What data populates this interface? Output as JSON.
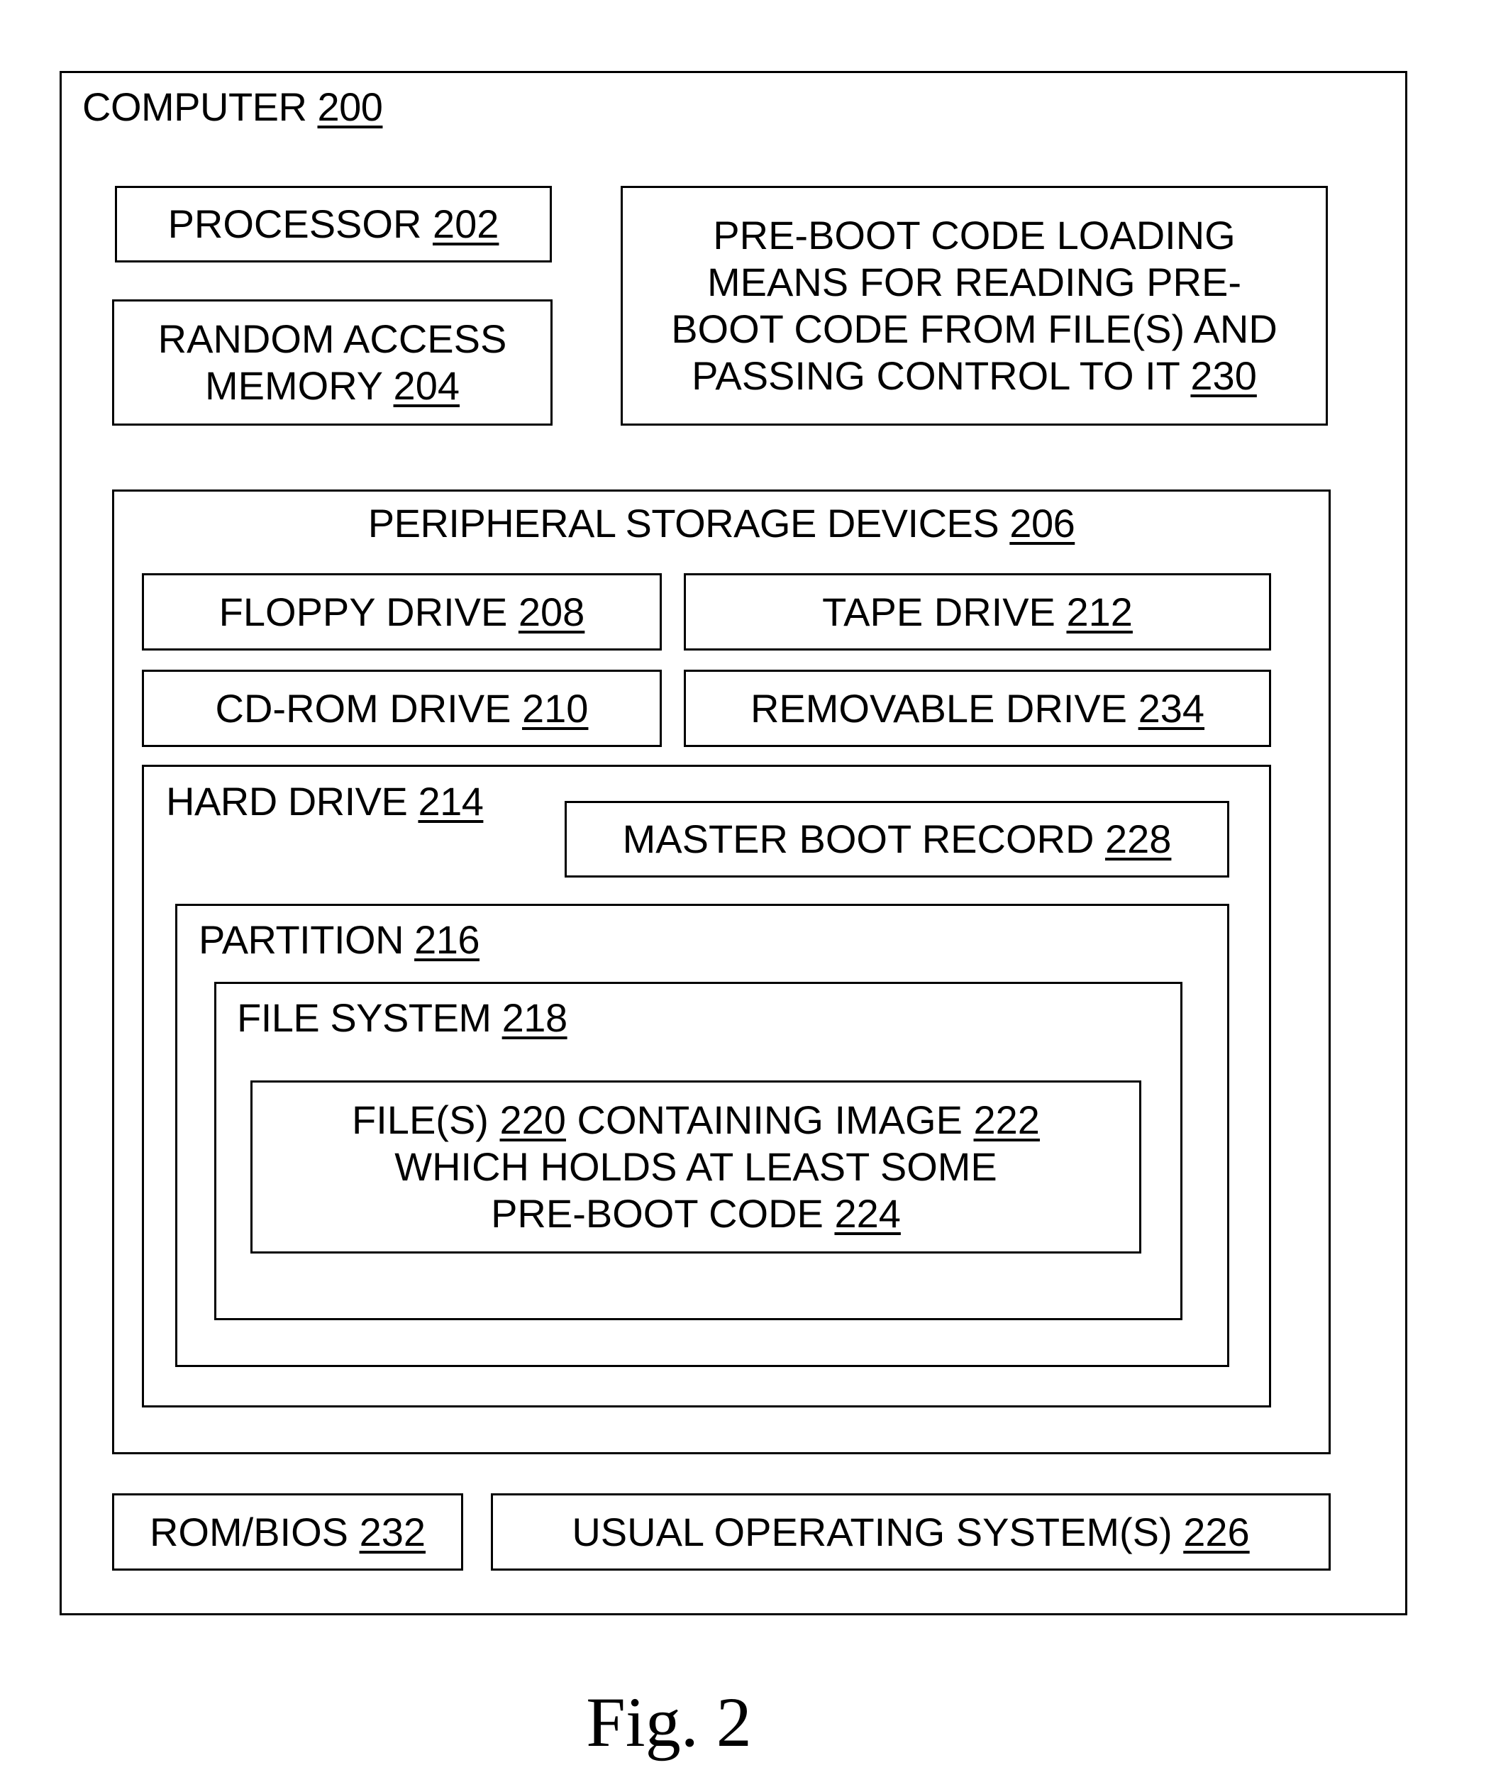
{
  "figure": {
    "caption": "Fig. 2",
    "computer": {
      "label": "COMPUTER",
      "ref": "200"
    },
    "processor": {
      "label": "PROCESSOR",
      "ref": "202"
    },
    "ram": {
      "line1": "RANDOM ACCESS",
      "line2": "MEMORY",
      "ref": "204"
    },
    "preboot_loader": {
      "line1": "PRE-BOOT CODE LOADING",
      "line2": "MEANS FOR READING PRE-",
      "line3": "BOOT CODE FROM FILE(S) AND",
      "line4": "PASSING CONTROL TO IT",
      "ref": "230"
    },
    "peripheral": {
      "label": "PERIPHERAL STORAGE DEVICES",
      "ref": "206"
    },
    "floppy": {
      "label": "FLOPPY DRIVE",
      "ref": "208"
    },
    "tape": {
      "label": "TAPE DRIVE",
      "ref": "212"
    },
    "cdrom": {
      "label": "CD-ROM DRIVE",
      "ref": "210"
    },
    "removable": {
      "label": "REMOVABLE DRIVE",
      "ref": "234"
    },
    "hard_drive": {
      "label": "HARD DRIVE",
      "ref": "214"
    },
    "mbr": {
      "label": "MASTER BOOT RECORD",
      "ref": "228"
    },
    "partition": {
      "label": "PARTITION",
      "ref": "216"
    },
    "file_system": {
      "label": "FILE SYSTEM",
      "ref": "218"
    },
    "files": {
      "part1": "FILE(S)",
      "ref1": "220",
      "part2": "CONTAINING IMAGE",
      "ref2": "222",
      "line2": "WHICH HOLDS AT LEAST SOME",
      "line3": "PRE-BOOT CODE",
      "ref3": "224"
    },
    "rom_bios": {
      "label": "ROM/BIOS",
      "ref": "232"
    },
    "os": {
      "label": "USUAL OPERATING SYSTEM(S)",
      "ref": "226"
    }
  }
}
